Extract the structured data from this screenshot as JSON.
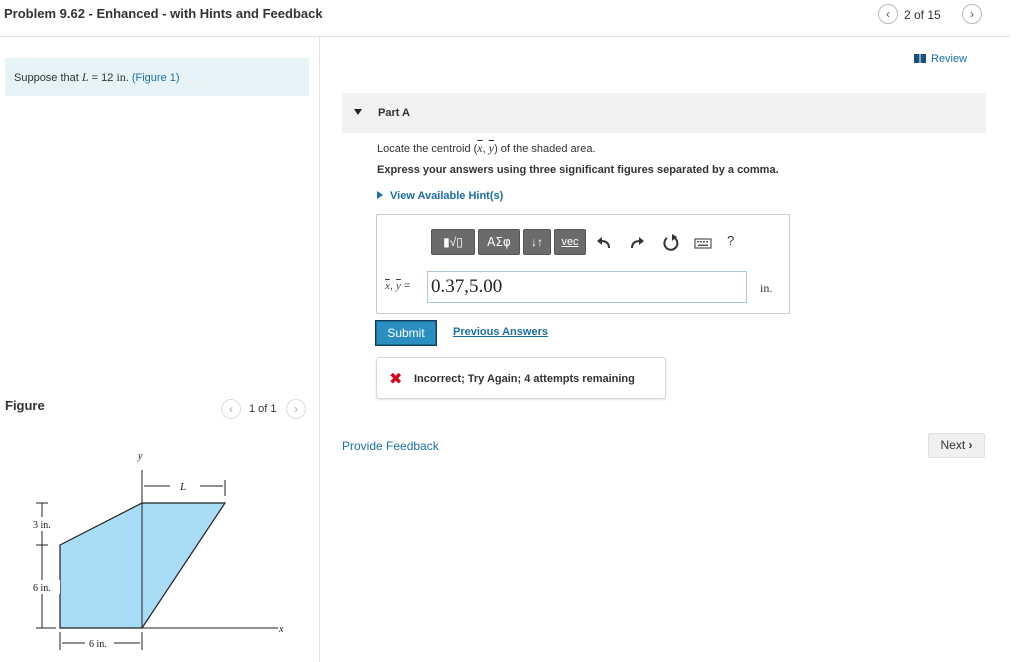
{
  "header": {
    "title": "Problem 9.62 - Enhanced - with Hints and Feedback",
    "nav_count": "2 of 15",
    "prev_icon": "‹",
    "next_icon": "›"
  },
  "statement": {
    "prefix": "Suppose that",
    "variable": "L",
    "equals": "= 12",
    "unit": "in.",
    "figure_link": "(Figure 1)"
  },
  "figure_panel": {
    "heading": "Figure",
    "count": "1 of 1",
    "labels": {
      "y_axis": "y",
      "x_axis": "x",
      "length": "L",
      "dim_3in": "3 in.",
      "dim_6in_vertical": "6 in.",
      "dim_6in_horizontal": "6 in."
    },
    "colors": {
      "shaded_area": "#a8dcf7",
      "outline": "#222222"
    }
  },
  "review": {
    "label": "Review",
    "icon": "book-icon"
  },
  "part": {
    "title": "Part A",
    "instruction_prefix": "Locate the centroid (",
    "xbar": "x",
    "comma": ",",
    "ybar": "y",
    "instruction_suffix": ") of the shaded area.",
    "express": "Express your answers using three significant figures separated by a comma.",
    "hint_link": "View Available Hint(s)"
  },
  "toolbar": {
    "templates_label": "▮√▯",
    "greek_label": "ΑΣφ",
    "arrows_label": "↓↑",
    "vec_label": "vec",
    "help_label": "?"
  },
  "answer": {
    "label_xbar": "x",
    "label_sep": ",",
    "label_ybar": "y",
    "label_eq": "=",
    "value": "0.37,5.00",
    "unit": "in."
  },
  "actions": {
    "submit_label": "Submit",
    "previous_answers": "Previous Answers"
  },
  "feedback": {
    "icon": "✖",
    "text": "Incorrect; Try Again; 4 attempts remaining"
  },
  "footer": {
    "provide_feedback": "Provide Feedback",
    "next_label": "Next",
    "next_icon": "›"
  },
  "colors": {
    "accent": "#1a6fa6",
    "submit": "#2b8ec0",
    "statement_bg": "#e6f4f7",
    "error": "#d0021b"
  }
}
